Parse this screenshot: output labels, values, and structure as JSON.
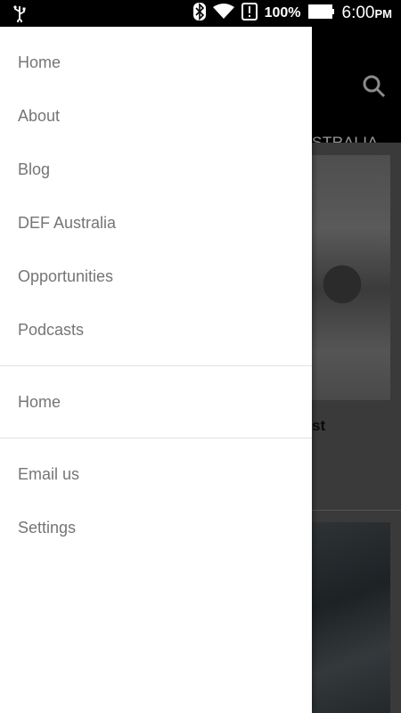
{
  "status_bar": {
    "battery_percent": "100%",
    "time": "6:00",
    "ampm": "PM",
    "icons": [
      "usb-icon",
      "bluetooth-icon",
      "wifi-icon",
      "alert-icon",
      "battery-icon"
    ]
  },
  "background": {
    "tab_partial": "STRALIA",
    "article_title_partial": "st"
  },
  "drawer": {
    "section1": [
      {
        "label": "Home"
      },
      {
        "label": "About"
      },
      {
        "label": "Blog"
      },
      {
        "label": "DEF Australia"
      },
      {
        "label": "Opportunities"
      },
      {
        "label": "Podcasts"
      }
    ],
    "section2": [
      {
        "label": "Home"
      }
    ],
    "section3": [
      {
        "label": "Email us"
      },
      {
        "label": "Settings"
      }
    ]
  }
}
